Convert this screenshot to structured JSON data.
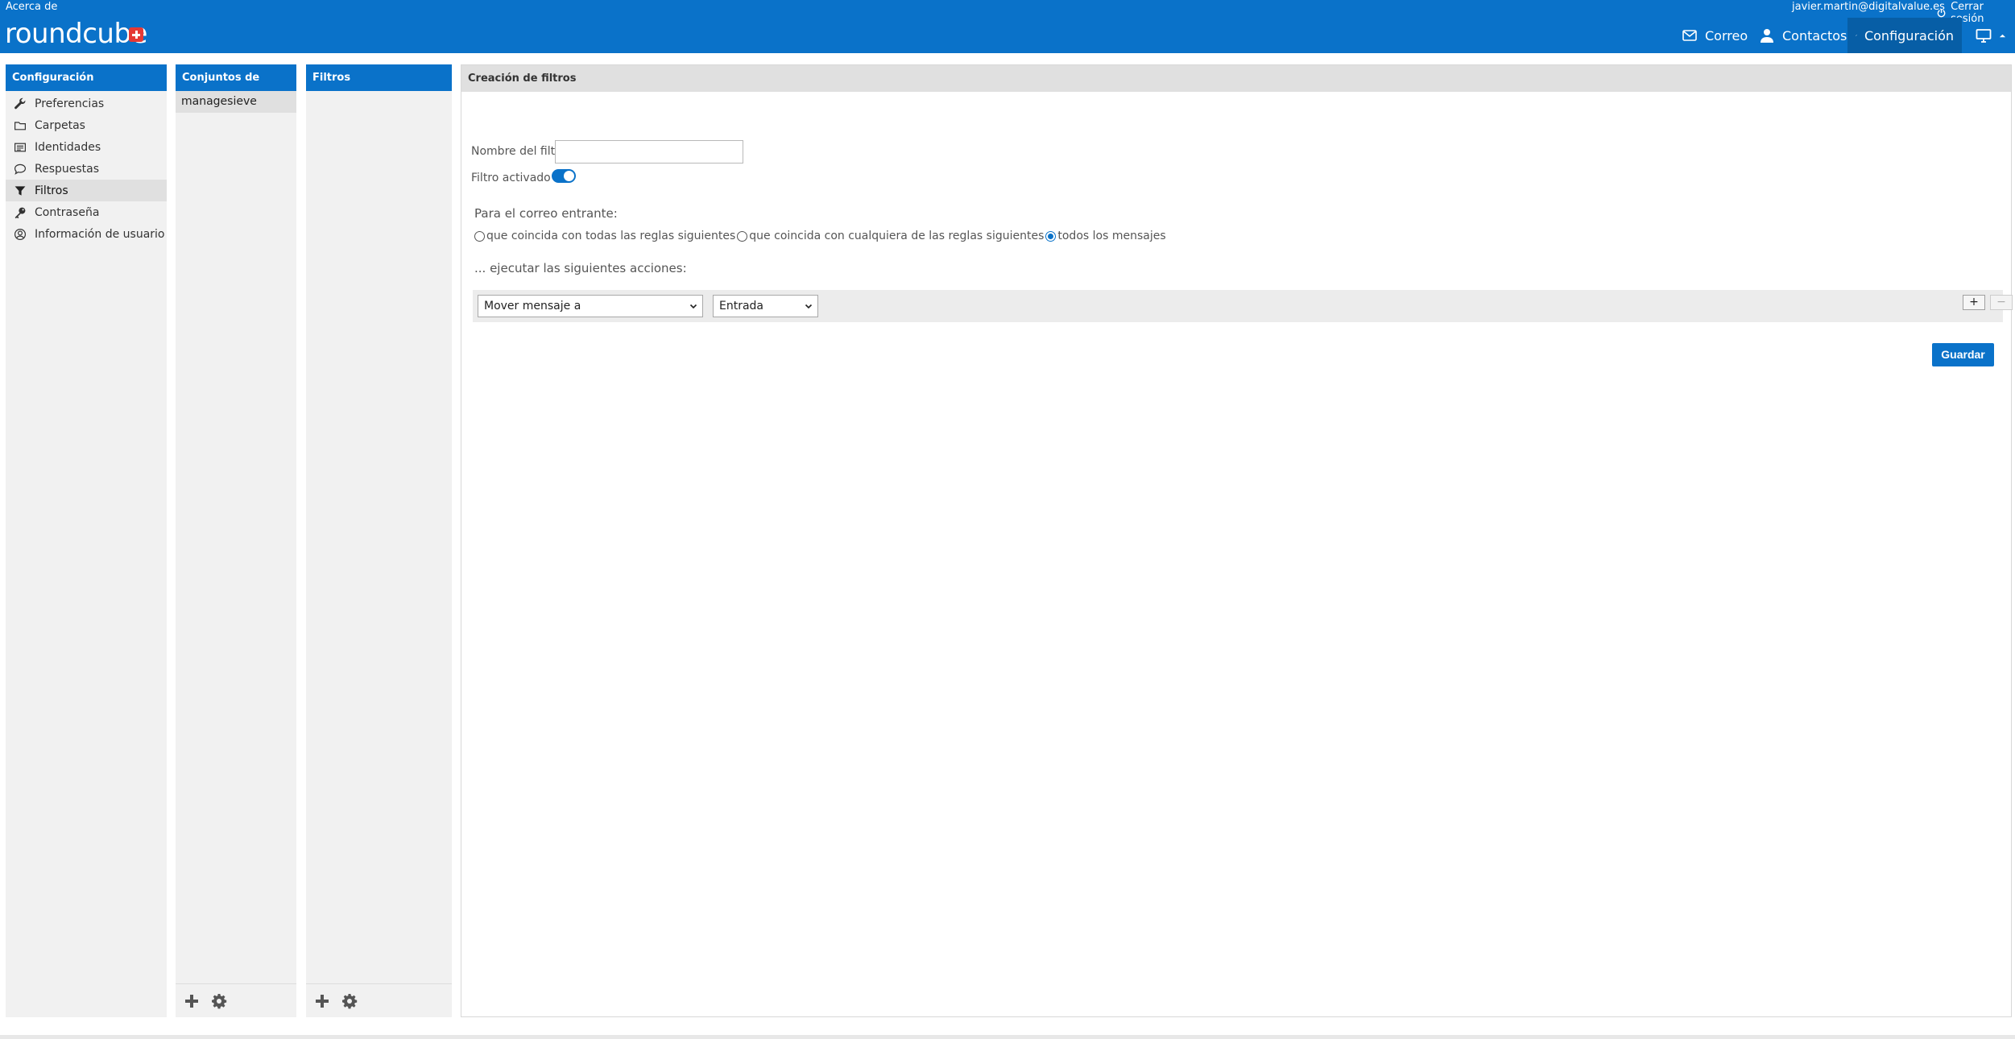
{
  "header": {
    "about": "Acerca de",
    "logo_text": "roundcube",
    "user_email": "javier.martin@digitalvalue.es",
    "logout": "Cerrar sesión",
    "nav": {
      "mail": "Correo",
      "contacts": "Contactos",
      "settings": "Configuración"
    }
  },
  "settings_menu": {
    "title": "Configuración",
    "items": [
      {
        "label": "Preferencias",
        "icon": "wrench-icon"
      },
      {
        "label": "Carpetas",
        "icon": "folder-icon"
      },
      {
        "label": "Identidades",
        "icon": "identity-card-icon"
      },
      {
        "label": "Respuestas",
        "icon": "speech-bubble-icon"
      },
      {
        "label": "Filtros",
        "icon": "filter-icon",
        "selected": true
      },
      {
        "label": "Contraseña",
        "icon": "key-icon"
      },
      {
        "label": "Información de usuario",
        "icon": "user-circle-icon"
      }
    ]
  },
  "filter_sets": {
    "title": "Conjuntos de filtros",
    "items": [
      "managesieve"
    ]
  },
  "filters": {
    "title": "Filtros",
    "items": []
  },
  "editor": {
    "title": "Creación de filtros",
    "name_label": "Nombre del filtro",
    "name_value": "",
    "active_label": "Filtro activado",
    "active": true,
    "incoming_label": "Para el correo entrante:",
    "match_options": [
      {
        "label": "que coincida con todas las reglas siguientes",
        "checked": false
      },
      {
        "label": "que coincida con cualquiera de las reglas siguientes",
        "checked": false
      },
      {
        "label": "todos los mensajes",
        "checked": true
      }
    ],
    "actions_label": "... ejecutar las siguientes acciones:",
    "action_select": "Mover mensaje a",
    "folder_select": "Entrada",
    "add_symbol": "+",
    "remove_symbol": "−",
    "save_label": "Guardar"
  },
  "colors": {
    "accent": "#0a72c9",
    "accent_dark": "#075ea6",
    "panel_bg": "#f1f1f1",
    "selected_bg": "#e0e0e0"
  }
}
